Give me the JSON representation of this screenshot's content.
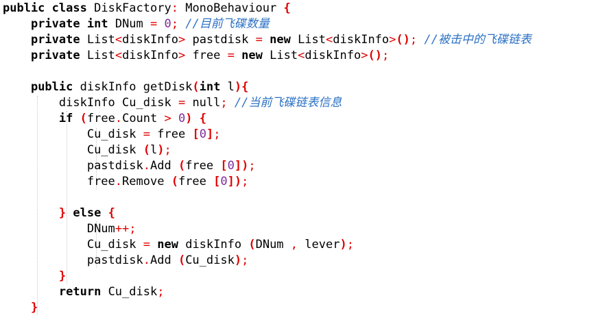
{
  "code": {
    "line1": {
      "kw1": "public",
      "kw2": "class",
      "name": "DiskFactory",
      "colon": ":",
      "base": "MonoBehaviour",
      "brace": "{"
    },
    "line2": {
      "kw1": "private",
      "kw2": "int",
      "name": "DNum",
      "eq": "=",
      "num": "0",
      "semi": ";",
      "comment": "//目前飞碟数量"
    },
    "line3": {
      "kw": "private",
      "type": "List",
      "lt": "<",
      "gen": "diskInfo",
      "gt": ">",
      "name": "pastdisk",
      "eq": "=",
      "new": "new",
      "type2": "List",
      "lt2": "<",
      "gen2": "diskInfo",
      "gt2": ">",
      "paren": "()",
      "semi": ";",
      "comment": "//被击中的飞碟链表"
    },
    "line4": {
      "kw": "private",
      "type": "List",
      "lt": "<",
      "gen": "diskInfo",
      "gt": ">",
      "name": "free",
      "eq": "=",
      "new": "new",
      "type2": "List",
      "lt2": "<",
      "gen2": "diskInfo",
      "gt2": ">",
      "paren": "()",
      "semi": ";"
    },
    "line6": {
      "kw1": "public",
      "type": "diskInfo",
      "method": "getDisk",
      "lparen": "(",
      "kw2": "int",
      "param": "l",
      "rparen": ")",
      "brace": "{"
    },
    "line7": {
      "type": "diskInfo",
      "name": "Cu_disk",
      "eq": "=",
      "val": "null",
      "semi": ";",
      "comment": "//当前飞碟链表信息"
    },
    "line8": {
      "kw": "if",
      "lparen": "(",
      "obj": "free",
      "dot": ".",
      "prop": "Count",
      "gt": ">",
      "num": "0",
      "rparen": ")",
      "brace": "{"
    },
    "line9": {
      "name": "Cu_disk",
      "eq": "=",
      "obj": "free",
      "lb": "[",
      "num": "0",
      "rb": "]",
      "semi": ";"
    },
    "line10": {
      "name": "Cu_disk",
      "lparen": "(",
      "arg": "l",
      "rparen": ")",
      "semi": ";"
    },
    "line11": {
      "obj": "pastdisk",
      "dot": ".",
      "method": "Add",
      "lparen": "(",
      "arg": "free",
      "lb": "[",
      "num": "0",
      "rb": "]",
      "rparen": ")",
      "semi": ";"
    },
    "line12": {
      "obj": "free",
      "dot": ".",
      "method": "Remove",
      "lparen": "(",
      "arg": "free",
      "lb": "[",
      "num": "0",
      "rb": "]",
      "rparen": ")",
      "semi": ";"
    },
    "line14": {
      "rbrace": "}",
      "kw": "else",
      "lbrace": "{"
    },
    "line15": {
      "name": "DNum",
      "op": "++",
      "semi": ";"
    },
    "line16": {
      "name": "Cu_disk",
      "eq": "=",
      "new": "new",
      "type": "diskInfo",
      "lparen": "(",
      "arg1": "DNum",
      "comma": ",",
      "arg2": "lever",
      "rparen": ")",
      "semi": ";"
    },
    "line17": {
      "obj": "pastdisk",
      "dot": ".",
      "method": "Add",
      "lparen": "(",
      "arg": "Cu_disk",
      "rparen": ")",
      "semi": ";"
    },
    "line18": {
      "brace": "}"
    },
    "line19": {
      "kw": "return",
      "name": "Cu_disk",
      "semi": ";"
    },
    "line20": {
      "brace": "}"
    }
  },
  "colors": {
    "keyword": "#000000",
    "operator": "#e00000",
    "number": "#7d2a9b",
    "comment": "#2d72c4",
    "indent_guide": "#c8c8c8",
    "background": "#ffffff"
  }
}
